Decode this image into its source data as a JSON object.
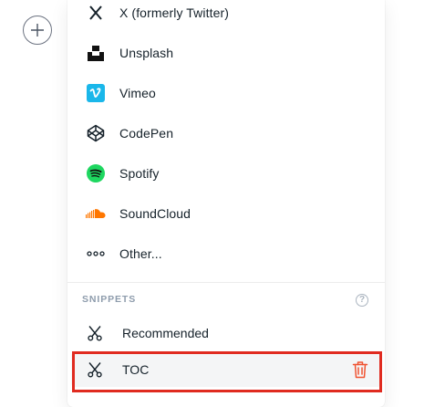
{
  "menu": {
    "items": [
      {
        "label": "X (formerly Twitter)",
        "icon": "x-icon"
      },
      {
        "label": "Unsplash",
        "icon": "unsplash-icon"
      },
      {
        "label": "Vimeo",
        "icon": "vimeo-icon"
      },
      {
        "label": "CodePen",
        "icon": "codepen-icon"
      },
      {
        "label": "Spotify",
        "icon": "spotify-icon"
      },
      {
        "label": "SoundCloud",
        "icon": "soundcloud-icon"
      },
      {
        "label": "Other...",
        "icon": "more-icon"
      }
    ],
    "section_title": "SNIPPETS",
    "help_glyph": "?",
    "snippets": [
      {
        "label": "Recommended",
        "icon": "snippet-scissors-icon"
      },
      {
        "label": "TOC",
        "icon": "snippet-scissors-icon",
        "action_icon": "trash-icon"
      }
    ]
  },
  "colors": {
    "vimeo": "#1ab7ea",
    "spotify": "#1ed760",
    "soundcloud": "#ff7700",
    "trash": "#f05230",
    "highlight": "#e02b20"
  }
}
